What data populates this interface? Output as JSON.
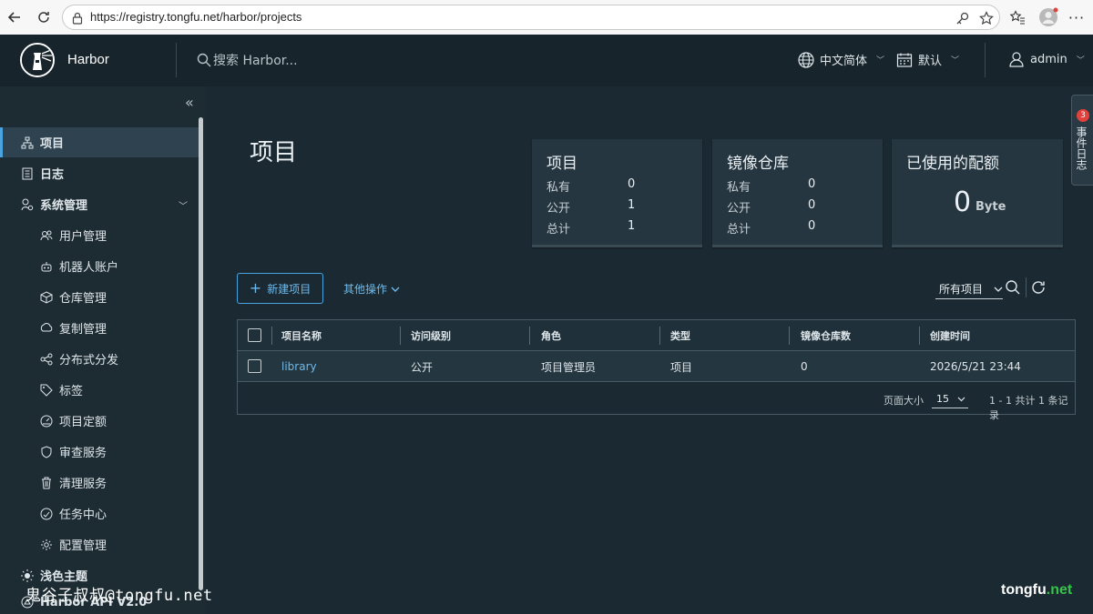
{
  "browser": {
    "url": "https://registry.tongfu.net/harbor/projects"
  },
  "header": {
    "brand": "Harbor",
    "search_placeholder": "搜索 Harbor...",
    "language": "中文简体",
    "theme_default": "默认",
    "user": "admin"
  },
  "sidebar": {
    "items": [
      {
        "label": "项目",
        "icon": "projects-icon"
      },
      {
        "label": "日志",
        "icon": "logs-icon"
      },
      {
        "label": "系统管理",
        "icon": "admin-icon"
      },
      {
        "label": "用户管理",
        "icon": "users-icon"
      },
      {
        "label": "机器人账户",
        "icon": "robot-icon"
      },
      {
        "label": "仓库管理",
        "icon": "registry-icon"
      },
      {
        "label": "复制管理",
        "icon": "replication-icon"
      },
      {
        "label": "分布式分发",
        "icon": "distribution-icon"
      },
      {
        "label": "标签",
        "icon": "tag-icon"
      },
      {
        "label": "项目定额",
        "icon": "quota-icon"
      },
      {
        "label": "审查服务",
        "icon": "shield-icon"
      },
      {
        "label": "清理服务",
        "icon": "trash-icon"
      },
      {
        "label": "任务中心",
        "icon": "task-icon"
      },
      {
        "label": "配置管理",
        "icon": "gear-icon"
      }
    ],
    "theme": "浅色主题",
    "api": "Harbor API V2.0"
  },
  "main": {
    "title": "项目",
    "cards": {
      "projects": {
        "title": "项目",
        "rows": [
          {
            "label": "私有",
            "value": "0"
          },
          {
            "label": "公开",
            "value": "1"
          },
          {
            "label": "总计",
            "value": "1"
          }
        ]
      },
      "repos": {
        "title": "镜像仓库",
        "rows": [
          {
            "label": "私有",
            "value": "0"
          },
          {
            "label": "公开",
            "value": "0"
          },
          {
            "label": "总计",
            "value": "0"
          }
        ]
      },
      "quota": {
        "title": "已使用的配额",
        "value": "0",
        "unit": "Byte"
      }
    },
    "new_project": "新建项目",
    "other_ops": "其他操作",
    "filter": "所有项目",
    "table": {
      "columns": [
        "项目名称",
        "访问级别",
        "角色",
        "类型",
        "镜像仓库数",
        "创建时间"
      ],
      "rows": [
        [
          "library",
          "公开",
          "项目管理员",
          "项目",
          "0",
          "2026/5/21 23:44"
        ]
      ]
    },
    "footer": {
      "page_size_label": "页面大小",
      "page_size": "15",
      "count": "1 - 1 共计 1 条记录"
    }
  },
  "event_log": {
    "label": "事件日志",
    "badge": "3"
  },
  "watermark": {
    "left": "鬼谷子叔叔@tongfu.net",
    "right_a": "tongfu",
    "right_b": ".net"
  },
  "colors": {
    "accent": "#4aa3df",
    "header_bg": "#17242b",
    "sidebar_bg": "#1d2b33",
    "main_bg": "#1b2a32"
  }
}
